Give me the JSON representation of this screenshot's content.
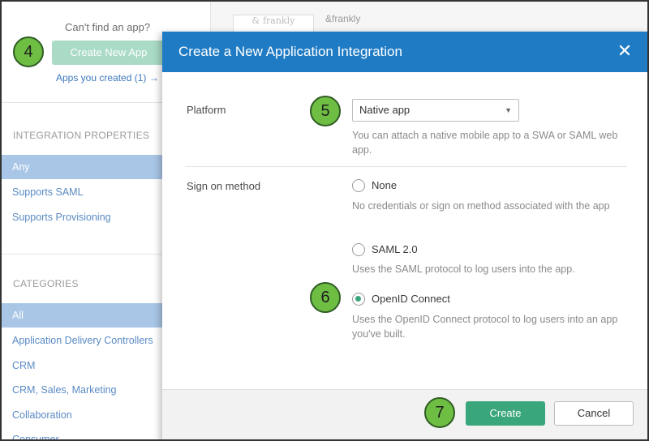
{
  "background": {
    "cant_find": "Can't find an app?",
    "create_new_app": "Create New App",
    "apps_created": "Apps you created (1) →",
    "integration_properties_heading": "INTEGRATION PROPERTIES",
    "integration_items": [
      {
        "label": "Any",
        "active": true
      },
      {
        "label": "Supports SAML",
        "active": false
      },
      {
        "label": "Supports Provisioning",
        "active": false
      }
    ],
    "categories_heading": "CATEGORIES",
    "category_items": [
      {
        "label": "All",
        "active": true
      },
      {
        "label": "Application Delivery Controllers",
        "active": false
      },
      {
        "label": "CRM",
        "active": false
      },
      {
        "label": "CRM, Sales, Marketing",
        "active": false
      },
      {
        "label": "Collaboration",
        "active": false
      },
      {
        "label": "Consumer",
        "active": false
      }
    ],
    "frankly_logo_text": "& frankly",
    "frankly_text": "&frankly"
  },
  "badges": {
    "step4": "4",
    "step5": "5",
    "step6": "6",
    "step7": "7"
  },
  "modal": {
    "title": "Create a New Application Integration",
    "close_icon": "close-icon",
    "platform_label": "Platform",
    "platform_value": "Native app",
    "platform_help": "You can attach a native mobile app to a SWA or SAML web app.",
    "sign_on_label": "Sign on method",
    "options": [
      {
        "label": "None",
        "help": "No credentials or sign on method associated with the app",
        "checked": false
      },
      {
        "label": "SAML 2.0",
        "help": "Uses the SAML protocol to log users into the app.",
        "checked": false
      },
      {
        "label": "OpenID Connect",
        "help": "Uses the OpenID Connect protocol to log users into an app you've built.",
        "checked": true
      }
    ],
    "create_label": "Create",
    "cancel_label": "Cancel"
  },
  "colors": {
    "header_blue": "#1f7bc4",
    "create_green": "#3aa67c",
    "badge_green": "#6fbe44",
    "sidebar_active": "#a9c6e6"
  }
}
